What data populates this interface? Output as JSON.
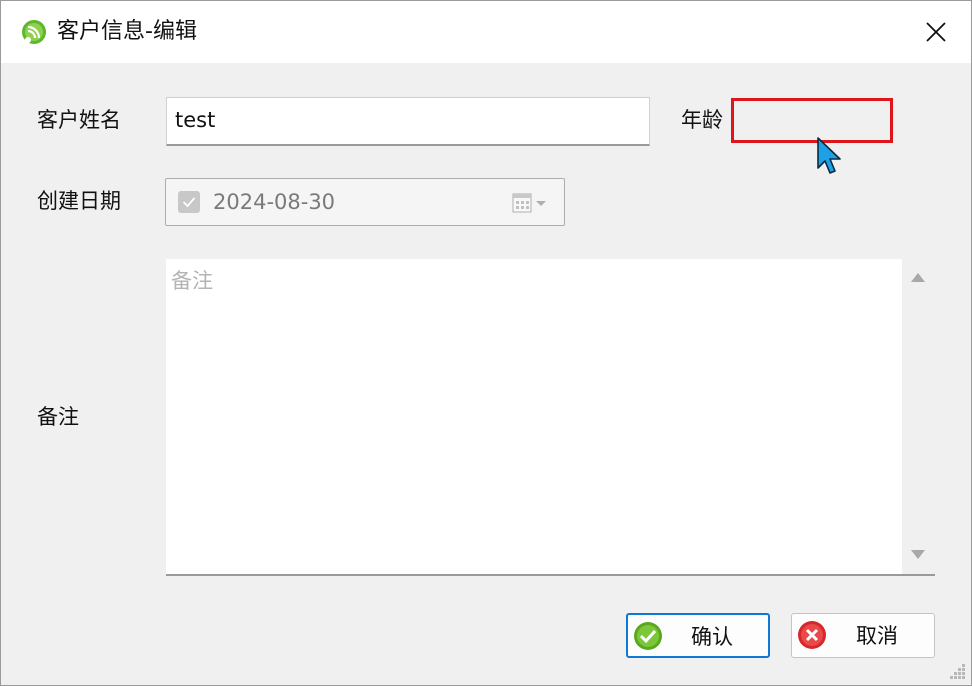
{
  "window": {
    "title": "客户信息-编辑",
    "close_glyph": "✕"
  },
  "form": {
    "name_label": "客户姓名",
    "name_value": "test",
    "age_label": "年龄",
    "age_value": "",
    "date_label": "创建日期",
    "date_value": "2024-08-30",
    "date_checked": true,
    "notes_label": "备注",
    "notes_placeholder": "备注",
    "notes_value": ""
  },
  "buttons": {
    "confirm_label": "确认",
    "cancel_label": "取消"
  },
  "colors": {
    "highlight_border": "#e0141b",
    "primary_border": "#0f78d7",
    "confirm_icon": "#5aa820",
    "cancel_icon": "#d8262b",
    "cursor": "#1ea0e6"
  },
  "icons": {
    "app": "rss-like-app-icon",
    "close": "close-icon",
    "calendar": "calendar-icon",
    "confirm": "check-circle-icon",
    "cancel": "x-circle-icon"
  }
}
